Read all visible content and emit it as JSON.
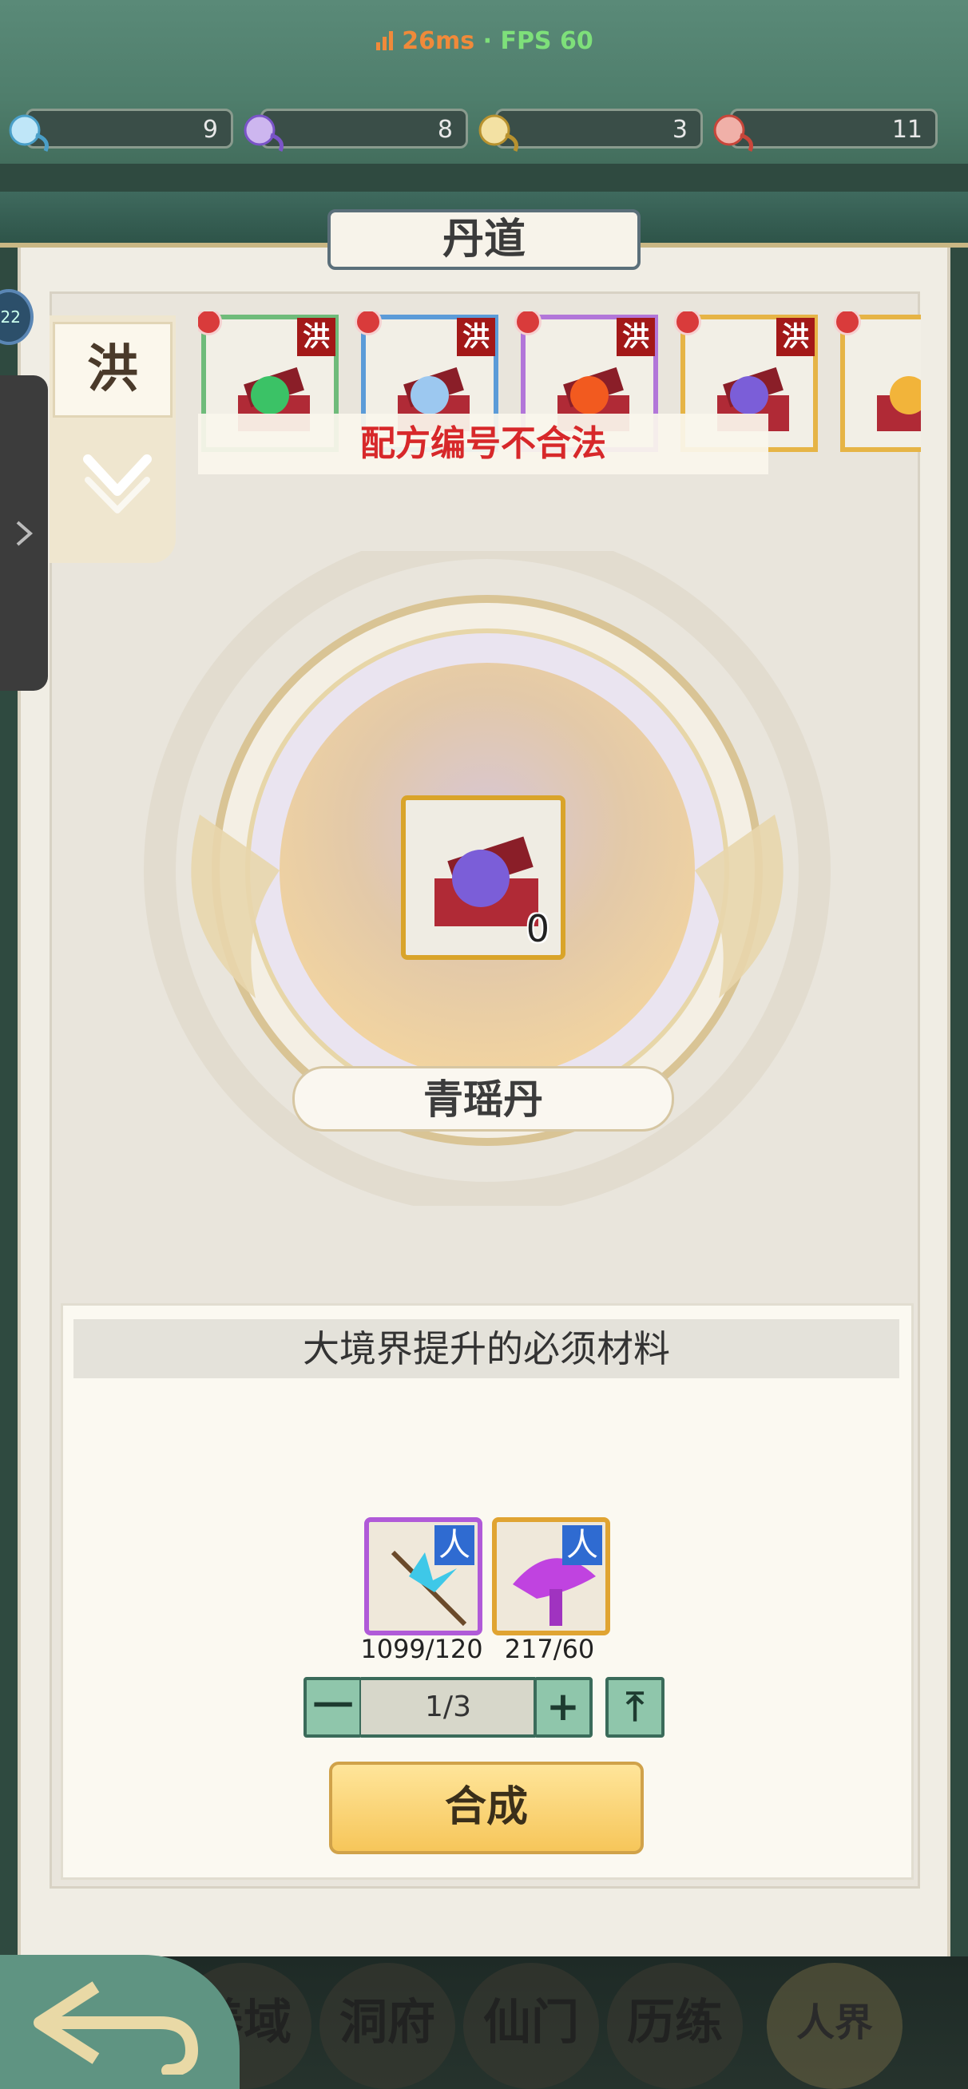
{
  "status": {
    "ping": "26ms",
    "separator": "·",
    "fps": "FPS 60"
  },
  "currencies": [
    {
      "icon": "blue-spirit-icon",
      "value": "9"
    },
    {
      "icon": "purple-spirit-icon",
      "value": "8"
    },
    {
      "icon": "gold-spirit-icon",
      "value": "3"
    },
    {
      "icon": "red-spirit-icon",
      "value": "11"
    }
  ],
  "header": {
    "title": "丹道"
  },
  "side_tab": {
    "label": "洪",
    "badge": "22"
  },
  "recipes": [
    {
      "seal": "洪",
      "orb_color": "#3bc266",
      "border": "#6fbb7a"
    },
    {
      "seal": "洪",
      "orb_color": "#9cc8f0",
      "border": "#5b9bd8"
    },
    {
      "seal": "洪",
      "orb_color": "#f25a1f",
      "border": "#b276d9"
    },
    {
      "seal": "洪",
      "orb_color": "#7b5ed8",
      "border": "#e6b446"
    },
    {
      "seal": "",
      "orb_color": "#f2b43a",
      "border": "#e6b446"
    }
  ],
  "toast": {
    "message": "配方编号不合法"
  },
  "selected_pill": {
    "name": "青瑶丹",
    "count": "0"
  },
  "materials": {
    "header": "大境界提升的必须材料",
    "items": [
      {
        "icon": "blue-herb-icon",
        "tag": "人",
        "count": "1099/120",
        "frame": "#b05ad8"
      },
      {
        "icon": "purple-mushroom-icon",
        "tag": "人",
        "count": "217/60",
        "frame": "#e0a432"
      }
    ]
  },
  "stepper": {
    "minus": "一",
    "value": "1/3",
    "plus": "+",
    "max": "⤒"
  },
  "craft_button": "合成",
  "bottom_nav": [
    {
      "label": "养域"
    },
    {
      "label": "洞府"
    },
    {
      "label": "仙门"
    },
    {
      "label": "历练"
    },
    {
      "label": "人界"
    }
  ]
}
